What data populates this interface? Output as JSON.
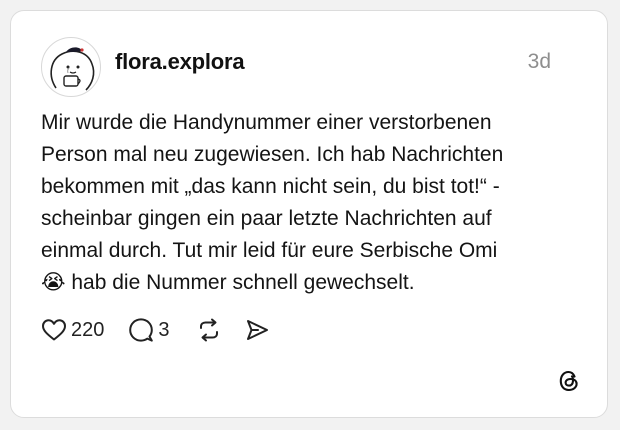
{
  "post": {
    "username": "flora.explora",
    "timestamp": "3d",
    "text": "Mir wurde die Handynummer einer verstorbenen\nPerson mal neu zugewiesen. Ich hab Nachrichten\nbekommen mit „das kann nicht sein, du bist tot!“ -\nscheinbar gingen ein paar letzte Nachrichten auf\neinmal durch. Tut mir leid für eure Serbische Omi\n😭 hab die Nummer schnell gewechselt.",
    "like_count": "220",
    "reply_count": "3"
  },
  "icons": {
    "like": "heart-icon",
    "reply": "comment-bubble-icon",
    "repost": "repost-icon",
    "share": "send-icon",
    "brand": "threads-logo-icon"
  },
  "colors": {
    "icon": "#222222",
    "muted": "#8e8e8e",
    "border": "#dcdcdc"
  }
}
